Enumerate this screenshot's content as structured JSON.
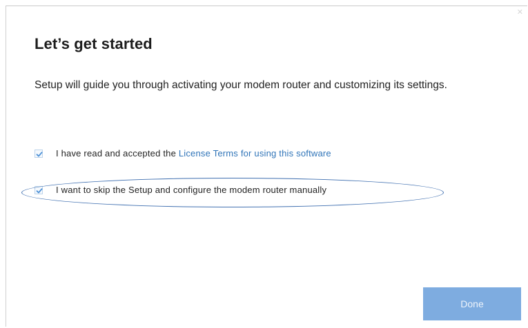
{
  "dialog": {
    "title": "Let’s get started",
    "intro": "Setup will guide you through activating your modem router and customizing its settings."
  },
  "options": [
    {
      "prefix": "I have read and accepted the ",
      "link_text": "License Terms for using this software",
      "checked": true
    },
    {
      "label": "I want to skip the Setup and configure the modem router manually",
      "checked": true
    }
  ],
  "actions": {
    "done_label": "Done"
  },
  "colors": {
    "link": "#2f74b8",
    "button": "#7eace0",
    "annotation": "#3f6fb0",
    "check": "#4a8fd6"
  },
  "icons": {
    "checkbox": "checkmark-icon"
  }
}
